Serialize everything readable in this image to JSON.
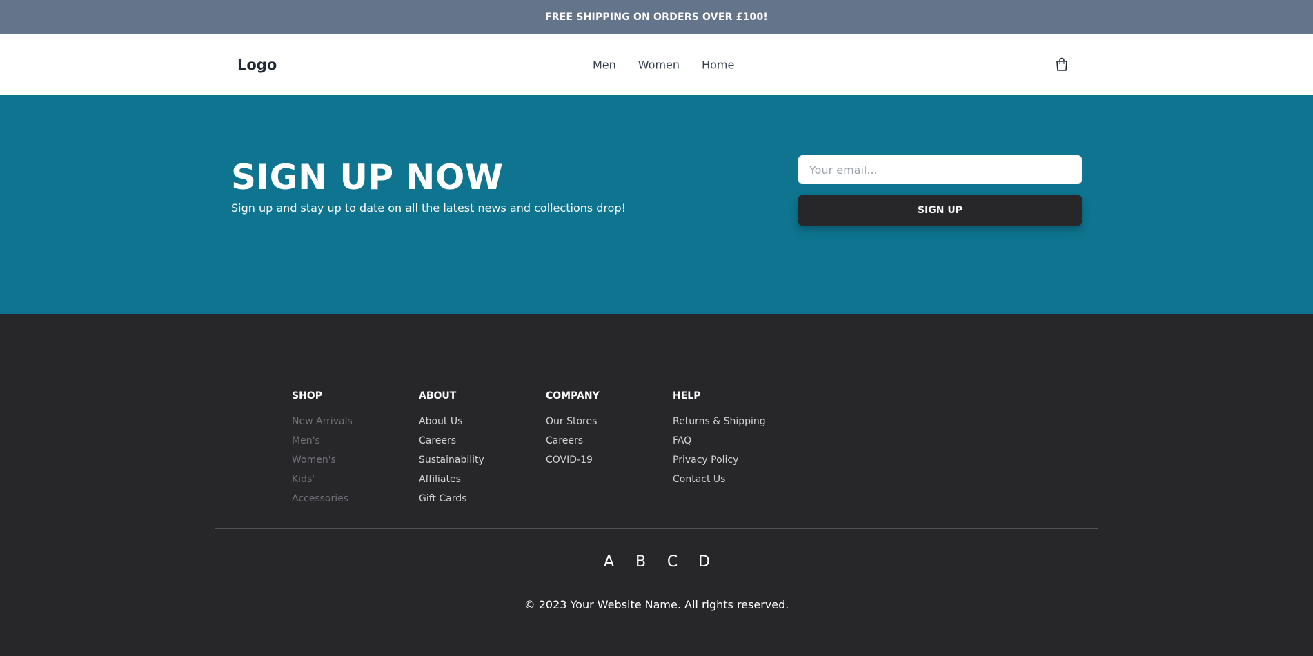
{
  "promo": {
    "text": "FREE SHIPPING ON ORDERS OVER £100!"
  },
  "nav": {
    "logo": "Logo",
    "links": [
      "Men",
      "Women",
      "Home"
    ],
    "cart_icon": "shopping-bag-icon"
  },
  "signup": {
    "title": "SIGN UP NOW",
    "subtitle": "Sign up and stay up to date on all the latest news and collections drop!",
    "email_placeholder": "Your email...",
    "button_label": "SIGN UP",
    "background_color": "#0e7490"
  },
  "footer": {
    "columns": [
      {
        "heading": "SHOP",
        "items": [
          "New Arrivals",
          "Men's",
          "Women's",
          "Kids'",
          "Accessories"
        ]
      },
      {
        "heading": "ABOUT",
        "items": [
          "About Us",
          "Careers",
          "Sustainability",
          "Affiliates",
          "Gift Cards"
        ]
      },
      {
        "heading": "COMPANY",
        "items": [
          "Our Stores",
          "Careers",
          "COVID-19"
        ]
      },
      {
        "heading": "HELP",
        "items": [
          "Returns & Shipping",
          "FAQ",
          "Privacy Policy",
          "Contact Us"
        ]
      }
    ],
    "social": [
      "A",
      "B",
      "C",
      "D"
    ],
    "copyright": "© 2023 Your Website Name. All rights reserved.",
    "background_color": "#27272a"
  }
}
